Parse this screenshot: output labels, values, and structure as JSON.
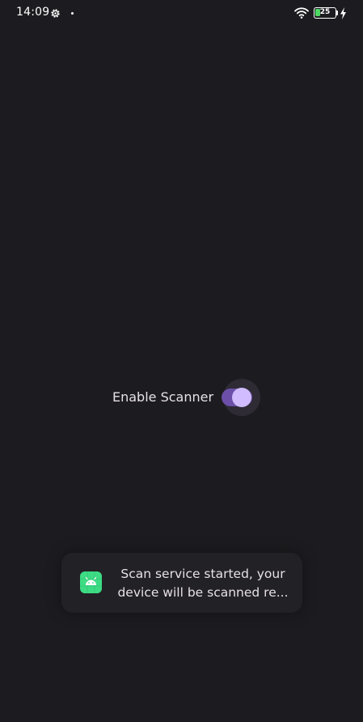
{
  "status_bar": {
    "time": "14:09",
    "battery_level": "25",
    "battery_percent": 25,
    "battery_color": "#4cd964",
    "icons": [
      "gear-icon",
      "notification-dot-icon",
      "wifi-icon",
      "battery-icon",
      "charging-bolt-icon"
    ]
  },
  "scanner": {
    "label": "Enable Scanner",
    "enabled": true,
    "accent_color": "#d0bcff",
    "track_color": "#6b4fa8"
  },
  "toast": {
    "line1": "Scan service started, your",
    "line2": "device will be scanned re...",
    "icon": "android-app-icon",
    "icon_color": "#3ddc84"
  },
  "colors": {
    "background": "#1c1b1f",
    "text": "#e6e1e5"
  }
}
